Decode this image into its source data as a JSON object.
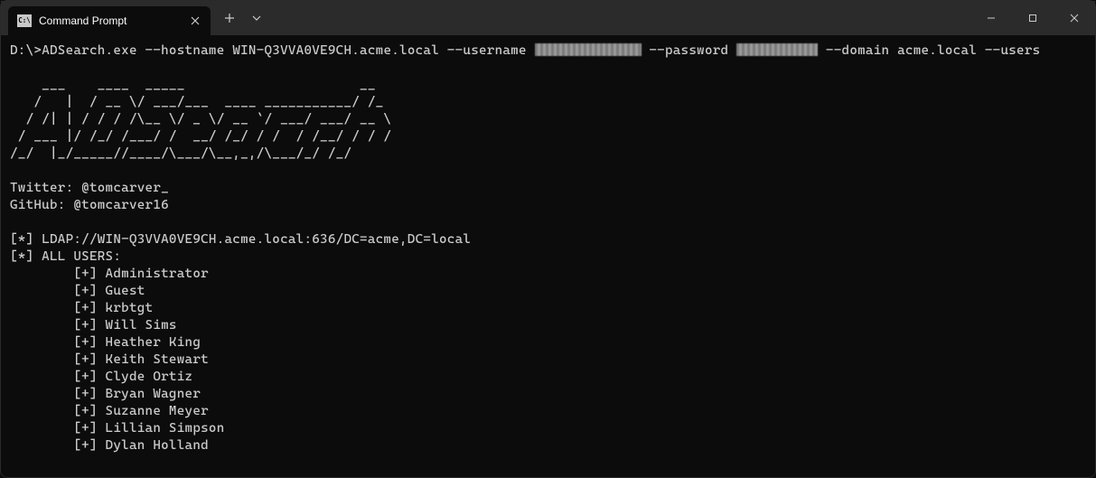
{
  "titlebar": {
    "tab_title": "Command Prompt"
  },
  "terminal": {
    "prompt": "D:\\>",
    "cmd": {
      "exe": "ADSearch.exe",
      "hostname_flag": " --hostname ",
      "hostname": "WIN-Q3VVA0VE9CH.acme.local",
      "username_flag": " --username ",
      "password_flag": " --password ",
      "domain_flag": " --domain ",
      "domain": "acme.local",
      "users_flag": " --users"
    },
    "ascii": "    ___    ____  _____                      __\n   /   |  / __ \\/ ___/___  ____ ___________/ /_\n  / /| | / / / /\\__ \\/ _ \\/ __ `/ ___/ ___/ __ \\\n / ___ |/ /_/ /___/ /  __/ /_/ / /  / /__/ / / /\n/_/  |_/_____//____/\\___/\\__,_,/\\___/_/ /_/",
    "twitter_label": "Twitter: ",
    "twitter": "@tomcarver_",
    "github_label": "GitHub: ",
    "github": "@tomcarver16",
    "ldap_prefix": "[*] ",
    "ldap": "LDAP://WIN-Q3VVA0VE9CH.acme.local:636/DC=acme,DC=local",
    "users_header": "[*] ALL USERS:",
    "entry_prefix": "\t[+] ",
    "users": [
      "Administrator",
      "Guest",
      "krbtgt",
      "Will Sims",
      "Heather King",
      "Keith Stewart",
      "Clyde Ortiz",
      "Bryan Wagner",
      "Suzanne Meyer",
      "Lillian Simpson",
      "Dylan Holland"
    ]
  }
}
